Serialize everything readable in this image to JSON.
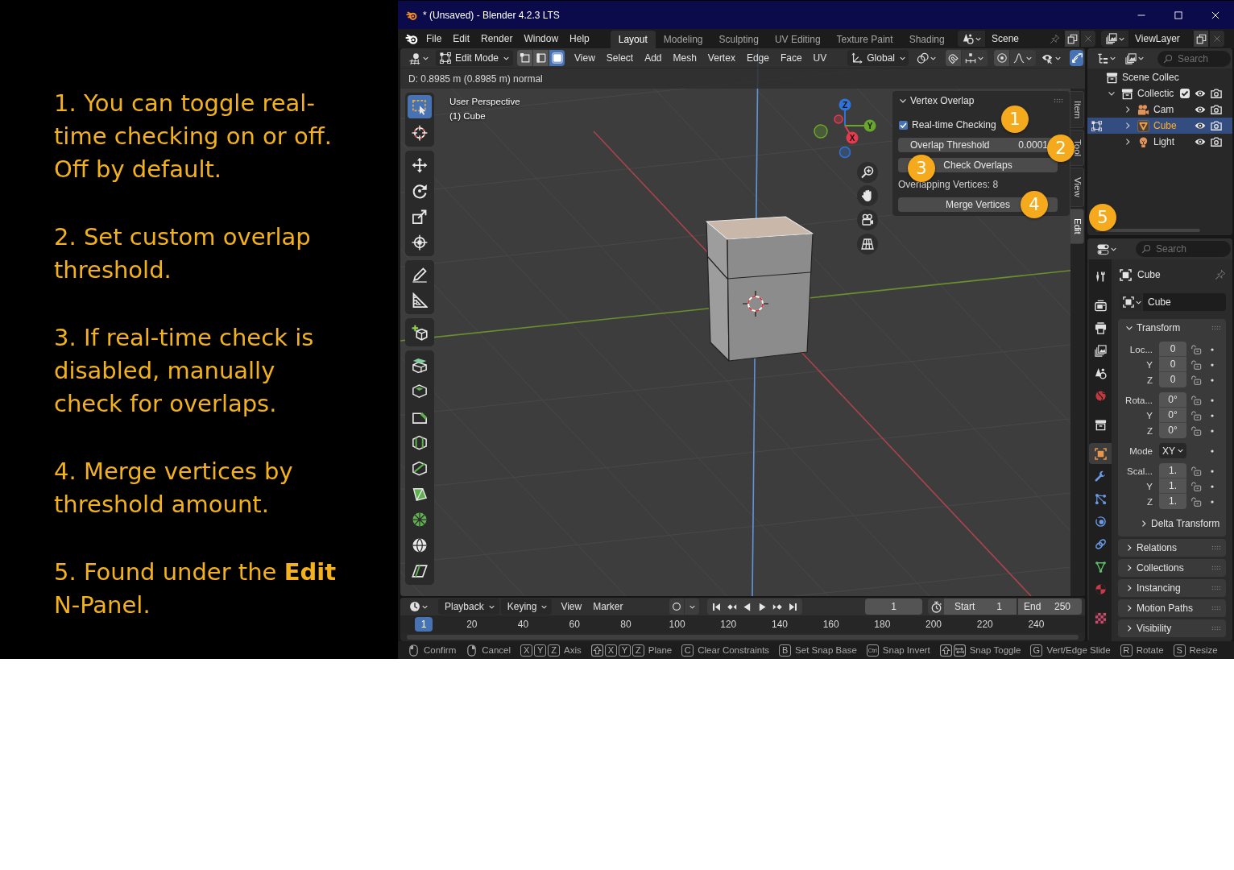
{
  "instructions": [
    "1. You can toggle real-time checking on or off. Off by default.",
    "2. Set custom overlap threshold.",
    "3. If real-time check is disabled, manually check for overlaps.",
    "4. Merge vertices by threshold amount.",
    "5. Found under the **Edit** N-Panel."
  ],
  "window": {
    "title": "* (Unsaved) - Blender 4.2.3 LTS"
  },
  "menu": [
    "File",
    "Edit",
    "Render",
    "Window",
    "Help"
  ],
  "workspaces": [
    {
      "label": "Layout",
      "selected": true
    },
    {
      "label": "Modeling",
      "selected": false
    },
    {
      "label": "Sculpting",
      "selected": false
    },
    {
      "label": "UV Editing",
      "selected": false
    },
    {
      "label": "Texture Paint",
      "selected": false
    },
    {
      "label": "Shading",
      "selected": false
    }
  ],
  "scene": "Scene",
  "view_layer": "ViewLayer",
  "viewport_header": {
    "mode": "Edit Mode",
    "select_modes": [
      {
        "kind": "vertex",
        "selected": false
      },
      {
        "kind": "edge",
        "selected": false
      },
      {
        "kind": "face",
        "selected": true
      }
    ],
    "menus": [
      "View",
      "Select",
      "Add",
      "Mesh",
      "Vertex",
      "Edge",
      "Face",
      "UV"
    ],
    "orientation": "Global",
    "show_gizmos": true
  },
  "status_text": "D: 0.8985 m (0.8985 m) normal",
  "viewport": {
    "view_name": "User Perspective",
    "object_label": "(1) Cube"
  },
  "navigation_gizmo": [
    {
      "label": "Z",
      "color": "#2f72d8"
    },
    {
      "label": "Y",
      "color": "#6aa62a"
    },
    {
      "label": "X",
      "color": "#e63a4e"
    }
  ],
  "tools": [
    {
      "kind": "select_box",
      "selected": true
    },
    {
      "kind": "cursor",
      "selected": false
    },
    {
      "kind": "move",
      "selected": false
    },
    {
      "kind": "rotate",
      "selected": false
    },
    {
      "kind": "scale",
      "selected": false
    },
    {
      "kind": "transform",
      "selected": false
    },
    {
      "kind": "annotate",
      "selected": false
    },
    {
      "kind": "measure",
      "selected": false
    },
    {
      "kind": "add_cube",
      "selected": false
    },
    {
      "kind": "extrude",
      "selected": false
    },
    {
      "kind": "inset",
      "selected": false
    },
    {
      "kind": "bevel",
      "selected": false
    },
    {
      "kind": "loop_cut",
      "selected": false
    },
    {
      "kind": "knife",
      "selected": false
    },
    {
      "kind": "poly_build",
      "selected": false
    },
    {
      "kind": "spin",
      "selected": false
    },
    {
      "kind": "smooth",
      "selected": false
    },
    {
      "kind": "shear",
      "selected": false
    }
  ],
  "sidebar_tabs": [
    {
      "label": "Item",
      "selected": false
    },
    {
      "label": "Tool",
      "selected": false
    },
    {
      "label": "View",
      "selected": false
    },
    {
      "label": "Edit",
      "selected": true
    }
  ],
  "sidebar_panel": {
    "title": "Vertex Overlap",
    "expanded": true,
    "realtime_checkbox": {
      "label": "Real-time Checking",
      "checked": true
    },
    "threshold": {
      "label": "Overlap Threshold",
      "value": "0.0001"
    },
    "check_button": "Check Overlaps",
    "result": "Overlapping Vertices: 8",
    "merge_button": "Merge Vertices"
  },
  "callouts": [
    "1",
    "2",
    "3",
    "4",
    "5"
  ],
  "outliner": {
    "search_placeholder": "Search",
    "tree": [
      {
        "label": "Scene Collec",
        "kind": "scene_collection",
        "selected": false,
        "children": [
          {
            "label": "Collectic",
            "kind": "collection",
            "selected": false,
            "checked": true,
            "expanded": true,
            "children": [
              {
                "label": "Cam",
                "kind": "camera",
                "selected": false,
                "expanded": false
              },
              {
                "label": "Cube",
                "kind": "mesh",
                "selected": true,
                "expanded": false,
                "edit_mode": true
              },
              {
                "label": "Light",
                "kind": "light",
                "selected": false,
                "expanded": false
              }
            ]
          }
        ]
      }
    ]
  },
  "properties": {
    "search_placeholder": "Search",
    "tabs": [
      {
        "kind": "tool",
        "selected": false
      },
      {
        "kind": "render",
        "selected": false
      },
      {
        "kind": "output",
        "selected": false
      },
      {
        "kind": "view_layer",
        "selected": false
      },
      {
        "kind": "scene",
        "selected": false
      },
      {
        "kind": "world",
        "selected": false
      },
      {
        "kind": "collection",
        "selected": false
      },
      {
        "kind": "object",
        "selected": true
      },
      {
        "kind": "modifiers",
        "selected": false
      },
      {
        "kind": "particles",
        "selected": false
      },
      {
        "kind": "physics",
        "selected": false
      },
      {
        "kind": "constraints",
        "selected": false
      },
      {
        "kind": "data",
        "selected": false
      },
      {
        "kind": "material",
        "selected": false
      },
      {
        "kind": "texture",
        "selected": false
      }
    ],
    "object_name": "Cube",
    "datablock_name": "Cube",
    "transform": {
      "title": "Transform",
      "expanded": true,
      "groups": [
        {
          "kind": "vector",
          "rows": [
            {
              "label": "Loc...",
              "value": "0"
            },
            {
              "label": "Y",
              "value": "0"
            },
            {
              "label": "Z",
              "value": "0"
            }
          ]
        },
        {
          "kind": "vector",
          "rows": [
            {
              "label": "Rota...",
              "value": "0°"
            },
            {
              "label": "Y",
              "value": "0°"
            },
            {
              "label": "Z",
              "value": "0°"
            }
          ]
        },
        {
          "kind": "dropdown",
          "rows": [
            {
              "label": "Mode",
              "value": "XY"
            }
          ]
        },
        {
          "kind": "vector",
          "rows": [
            {
              "label": "Scal...",
              "value": "1."
            },
            {
              "label": "Y",
              "value": "1."
            },
            {
              "label": "Z",
              "value": "1."
            }
          ]
        }
      ],
      "subpanel": {
        "title": "Delta Transform",
        "expanded": false
      }
    },
    "panels": [
      {
        "title": "Relations",
        "expanded": false
      },
      {
        "title": "Collections",
        "expanded": false
      },
      {
        "title": "Instancing",
        "expanded": false
      },
      {
        "title": "Motion Paths",
        "expanded": false
      },
      {
        "title": "Visibility",
        "expanded": false
      }
    ]
  },
  "timeline": {
    "menus": [
      {
        "label": "Playback",
        "kind": "dropdown"
      },
      {
        "label": "Keying",
        "kind": "dropdown"
      },
      {
        "label": "View",
        "kind": "menu"
      },
      {
        "label": "Marker",
        "kind": "menu"
      }
    ],
    "current_frame": "1",
    "start": {
      "label": "Start",
      "value": "1"
    },
    "end": {
      "label": "End",
      "value": "250"
    },
    "playhead": "1",
    "ruler": [
      "20",
      "40",
      "60",
      "80",
      "100",
      "120",
      "140",
      "160",
      "180",
      "200",
      "220",
      "240"
    ]
  },
  "status_bar": [
    {
      "keys": [
        {
          "kind": "mouse_left"
        }
      ],
      "label": "Confirm"
    },
    {
      "keys": [
        {
          "kind": "mouse_right"
        }
      ],
      "label": "Cancel"
    },
    {
      "keys": [
        {
          "kind": "key",
          "label": "X"
        },
        {
          "kind": "key",
          "label": "Y"
        },
        {
          "kind": "key",
          "label": "Z"
        }
      ],
      "label": "Axis"
    },
    {
      "keys": [
        {
          "kind": "shift"
        },
        {
          "kind": "key",
          "label": "X"
        },
        {
          "kind": "key",
          "label": "Y"
        },
        {
          "kind": "key",
          "label": "Z"
        }
      ],
      "label": "Plane"
    },
    {
      "keys": [
        {
          "kind": "key",
          "label": "C"
        }
      ],
      "label": "Clear Constraints"
    },
    {
      "keys": [
        {
          "kind": "key",
          "label": "B"
        }
      ],
      "label": "Set Snap Base"
    },
    {
      "keys": [
        {
          "kind": "modifier",
          "label": "Ctrl"
        }
      ],
      "label": "Snap Invert"
    },
    {
      "keys": [
        {
          "kind": "shift"
        },
        {
          "kind": "tab"
        }
      ],
      "label": "Snap Toggle"
    },
    {
      "keys": [
        {
          "kind": "key",
          "label": "G"
        }
      ],
      "label": "Vert/Edge Slide"
    },
    {
      "keys": [
        {
          "kind": "key",
          "label": "R"
        }
      ],
      "label": "Rotate"
    },
    {
      "keys": [
        {
          "kind": "key",
          "label": "S"
        }
      ],
      "label": "Resize"
    }
  ]
}
